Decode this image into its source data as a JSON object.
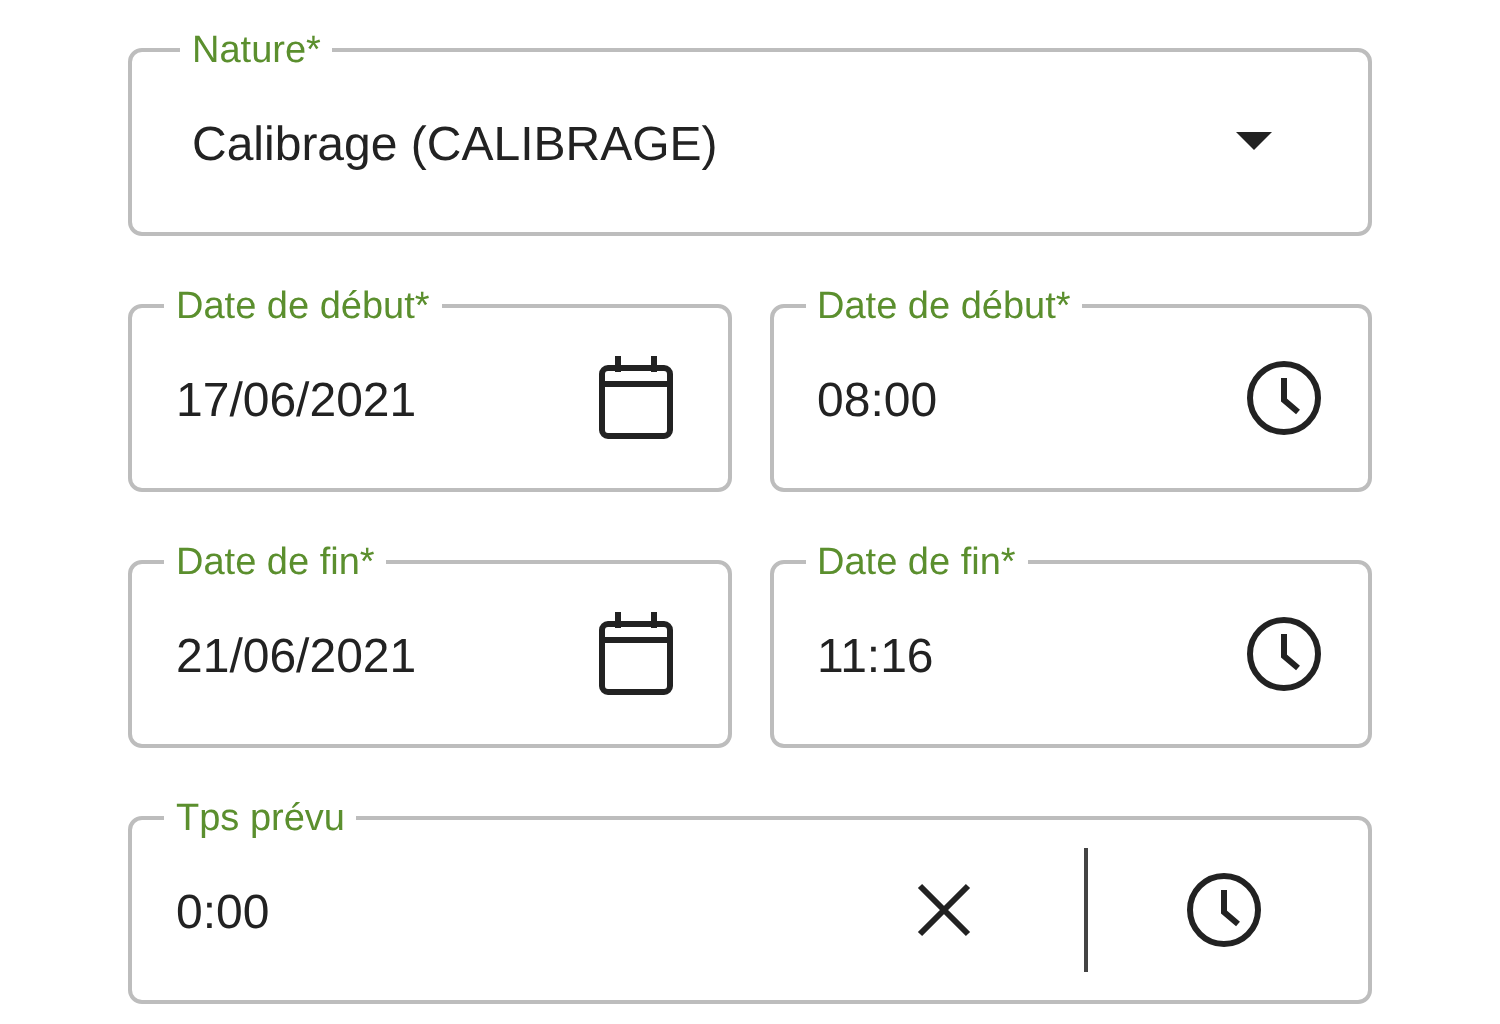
{
  "rows": [
    [
      {
        "label": "Nature*",
        "value": "Calibrage (CALIBRAGE)",
        "kind": "select"
      }
    ],
    [
      {
        "label": "Date de début*",
        "value": "17/06/2021",
        "kind": "date"
      },
      {
        "label": "Date de début*",
        "value": "08:00",
        "kind": "time"
      }
    ],
    [
      {
        "label": "Date de fin*",
        "value": "21/06/2021",
        "kind": "date"
      },
      {
        "label": "Date de fin*",
        "value": "11:16",
        "kind": "time"
      }
    ],
    [
      {
        "label": "Tps prévu",
        "value": "0:00",
        "kind": "duration"
      }
    ]
  ]
}
